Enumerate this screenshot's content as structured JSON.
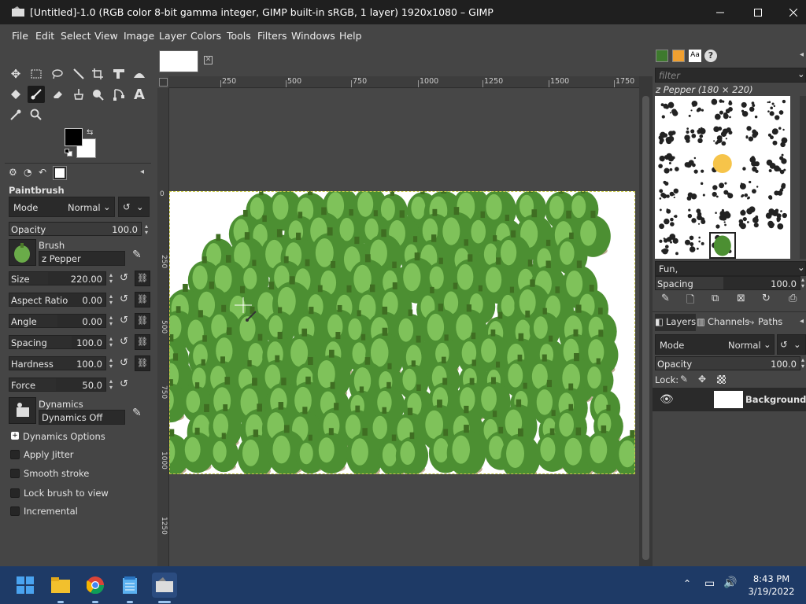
{
  "window": {
    "title": "[Untitled]-1.0 (RGB color 8-bit gamma integer, GIMP built-in sRGB, 1 layer) 1920x1080 – GIMP",
    "controls": {
      "minimize": "—",
      "maximize": "☐",
      "close": "✕"
    }
  },
  "menu": [
    "File",
    "Edit",
    "Select",
    "View",
    "Image",
    "Layer",
    "Colors",
    "Tools",
    "Filters",
    "Windows",
    "Help"
  ],
  "tool_options": {
    "title": "Paintbrush",
    "mode_label": "Mode",
    "mode_value": "Normal",
    "opacity_label": "Opacity",
    "opacity_value": "100.0",
    "brush_label": "Brush",
    "brush_value": "z Pepper",
    "size_label": "Size",
    "size_value": "220.00",
    "aspect_label": "Aspect Ratio",
    "aspect_value": "0.00",
    "angle_label": "Angle",
    "angle_value": "0.00",
    "spacing_label": "Spacing",
    "spacing_value": "100.0",
    "hardness_label": "Hardness",
    "hardness_value": "100.0",
    "force_label": "Force",
    "force_value": "50.0",
    "dynamics_label": "Dynamics",
    "dynamics_value": "Dynamics Off",
    "dynamics_options": "Dynamics Options",
    "apply_jitter": "Apply Jitter",
    "smooth_stroke": "Smooth stroke",
    "lock_brush": "Lock brush to view",
    "incremental": "Incremental"
  },
  "rulers": {
    "h_labels": [
      "250",
      "500",
      "750",
      "1000",
      "1250",
      "1500",
      "1750"
    ],
    "v_labels": [
      "0",
      "250",
      "500",
      "750",
      "1000",
      "1250"
    ]
  },
  "brushes_dock": {
    "filter_placeholder": "filter",
    "brush_name": "z Pepper (180 × 220)",
    "tag_value": "Fun,",
    "spacing_label": "Spacing",
    "spacing_value": "100.0"
  },
  "layers_dock": {
    "tabs": [
      "Layers",
      "Channels",
      "Paths"
    ],
    "mode_label": "Mode",
    "mode_value": "Normal",
    "opacity_label": "Opacity",
    "opacity_value": "100.0",
    "lock_label": "Lock:",
    "layer_name": "Background"
  },
  "taskbar": {
    "time": "8:43 PM",
    "date": "3/19/2022",
    "apps": [
      "start-icon",
      "file-explorer-icon",
      "chrome-icon",
      "notepad-icon",
      "gimp-icon"
    ]
  },
  "colors": {
    "accent": "#2f80d8",
    "pepper_dark": "#4c8f32",
    "pepper_light": "#7fc25a"
  }
}
